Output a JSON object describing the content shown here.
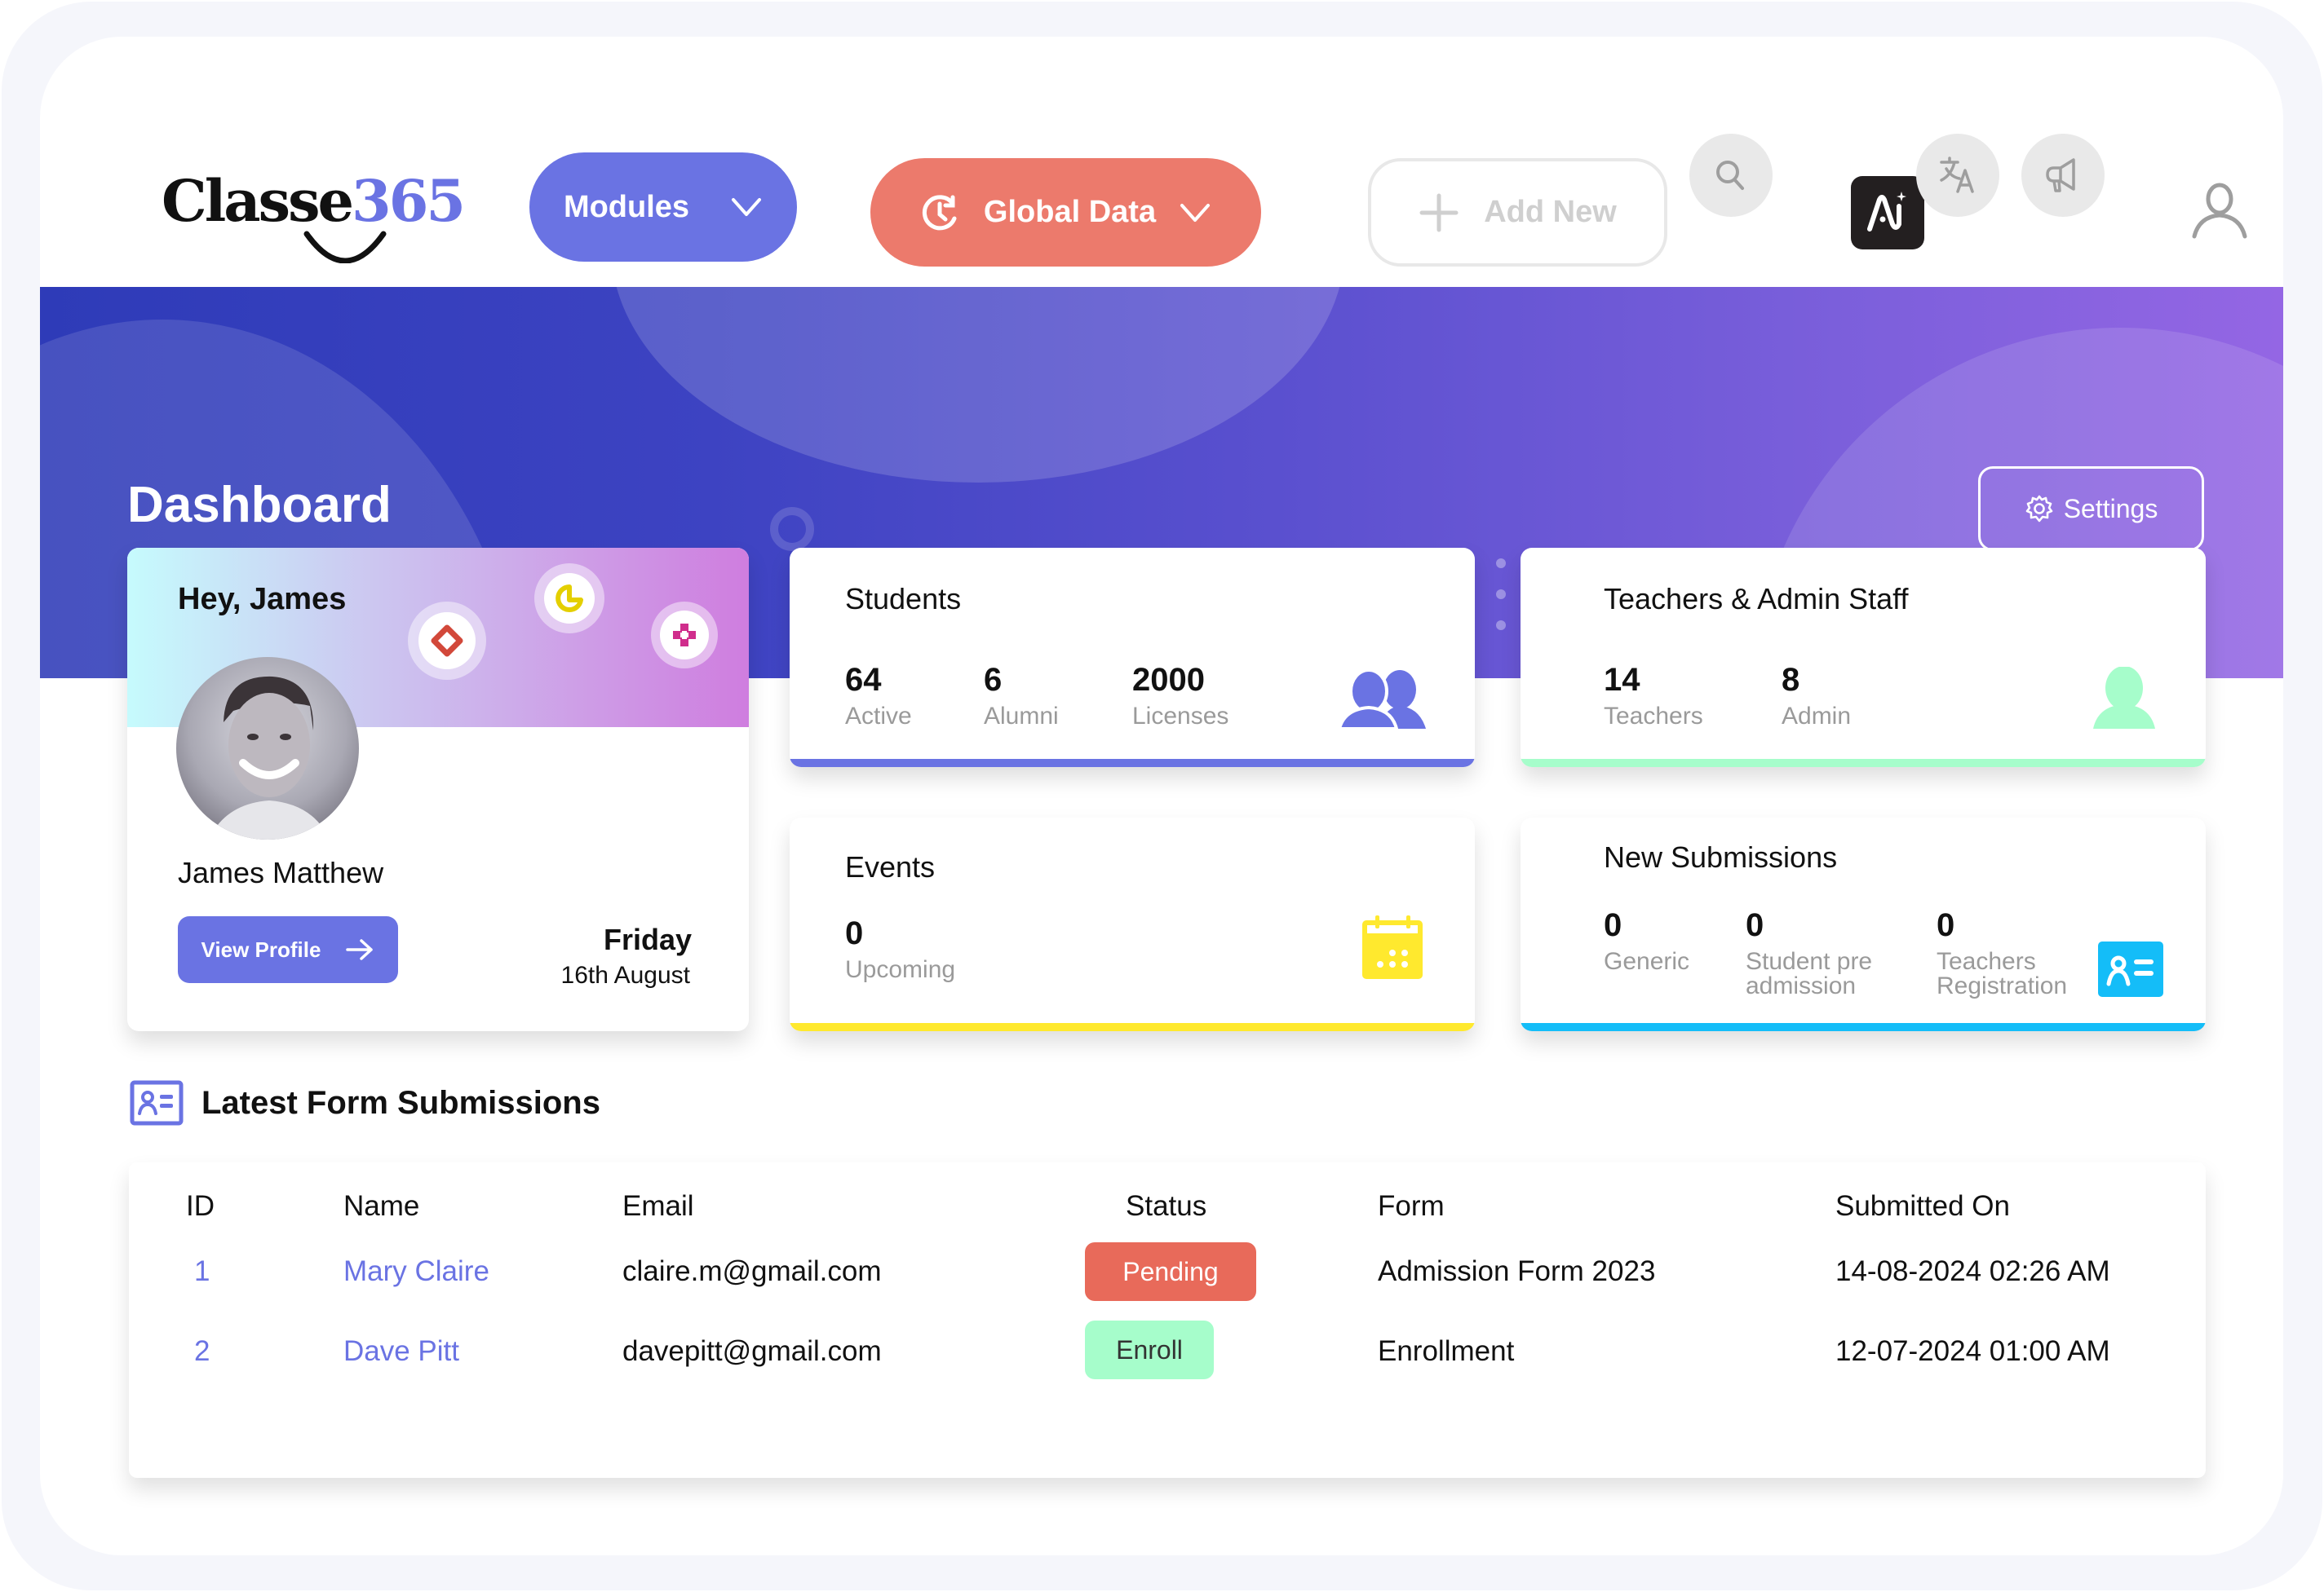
{
  "header": {
    "logo": {
      "word": "Classe",
      "number": "365"
    },
    "modules_label": "Modules",
    "global_data_label": "Global Data",
    "add_new_label": "Add New",
    "icons": [
      "search-icon",
      "ai-icon",
      "translate-icon",
      "megaphone-icon",
      "user-icon"
    ]
  },
  "banner": {
    "title": "Dashboard",
    "settings_label": "Settings"
  },
  "profile": {
    "greeting": "Hey, James",
    "name": "James Matthew",
    "view_profile_label": "View Profile",
    "day": "Friday",
    "date": "16th August"
  },
  "students": {
    "title": "Students",
    "stats": [
      {
        "value": "64",
        "label": "Active"
      },
      {
        "value": "6",
        "label": "Alumni"
      },
      {
        "value": "2000",
        "label": "Licenses"
      }
    ],
    "accent": "#6a73e3"
  },
  "teachers": {
    "title": "Teachers & Admin Staff",
    "stats": [
      {
        "value": "14",
        "label": "Teachers"
      },
      {
        "value": "8",
        "label": "Admin"
      }
    ],
    "accent": "#a6fdcb"
  },
  "events": {
    "title": "Events",
    "stats": [
      {
        "value": "0",
        "label": "Upcoming"
      }
    ],
    "accent": "#ffe92e"
  },
  "submissions": {
    "title": "New Submissions",
    "stats": [
      {
        "value": "0",
        "label": "Generic"
      },
      {
        "value": "0",
        "label": "Student pre admission"
      },
      {
        "value": "0",
        "label": "Teachers Registration"
      }
    ],
    "accent": "#14bdf8"
  },
  "latest": {
    "title": "Latest Form Submissions",
    "columns": [
      "ID",
      "Name",
      "Email",
      "Status",
      "Form",
      "Submitted On"
    ],
    "rows": [
      {
        "id": "1",
        "name": "Mary Claire",
        "email": "claire.m@gmail.com",
        "status": "Pending",
        "form": "Admission Form 2023",
        "submitted": "14-08-2024 02:26 AM"
      },
      {
        "id": "2",
        "name": "Dave Pitt",
        "email": "davepitt@gmail.com",
        "status": "Enroll",
        "form": "Enrollment",
        "submitted": "12-07-2024 01:00 AM"
      }
    ]
  },
  "colors": {
    "primary": "#6a73e3",
    "global_data": "#ec7a6c",
    "pending": "#e86a5a",
    "enroll": "#a6fdcb"
  }
}
